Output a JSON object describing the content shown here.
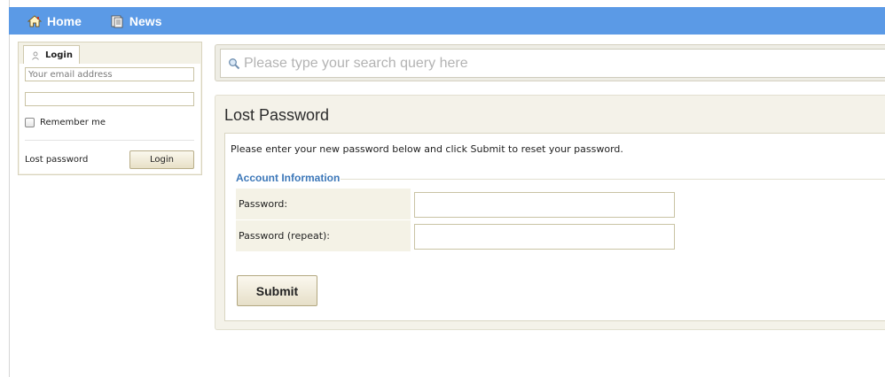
{
  "nav": {
    "items": [
      {
        "label": "Home",
        "icon": "home-icon"
      },
      {
        "label": "News",
        "icon": "news-icon"
      }
    ],
    "bar_color": "#5b9ae6"
  },
  "login": {
    "tab_label": "Login",
    "email_placeholder": "Your email address",
    "password_value": "",
    "remember_label": "Remember me",
    "lost_password_label": "Lost password",
    "login_button_label": "Login"
  },
  "search": {
    "placeholder": "Please type your search query here"
  },
  "lost_password": {
    "title": "Lost Password",
    "intro": "Please enter your new password below and click Submit to reset your password.",
    "fieldset_legend": "Account Information",
    "fields": [
      {
        "label": "Password:"
      },
      {
        "label": "Password (repeat):"
      }
    ],
    "submit_label": "Submit"
  },
  "colors": {
    "legend": "#3d78b9",
    "panel_bg": "#f4f2e9"
  }
}
